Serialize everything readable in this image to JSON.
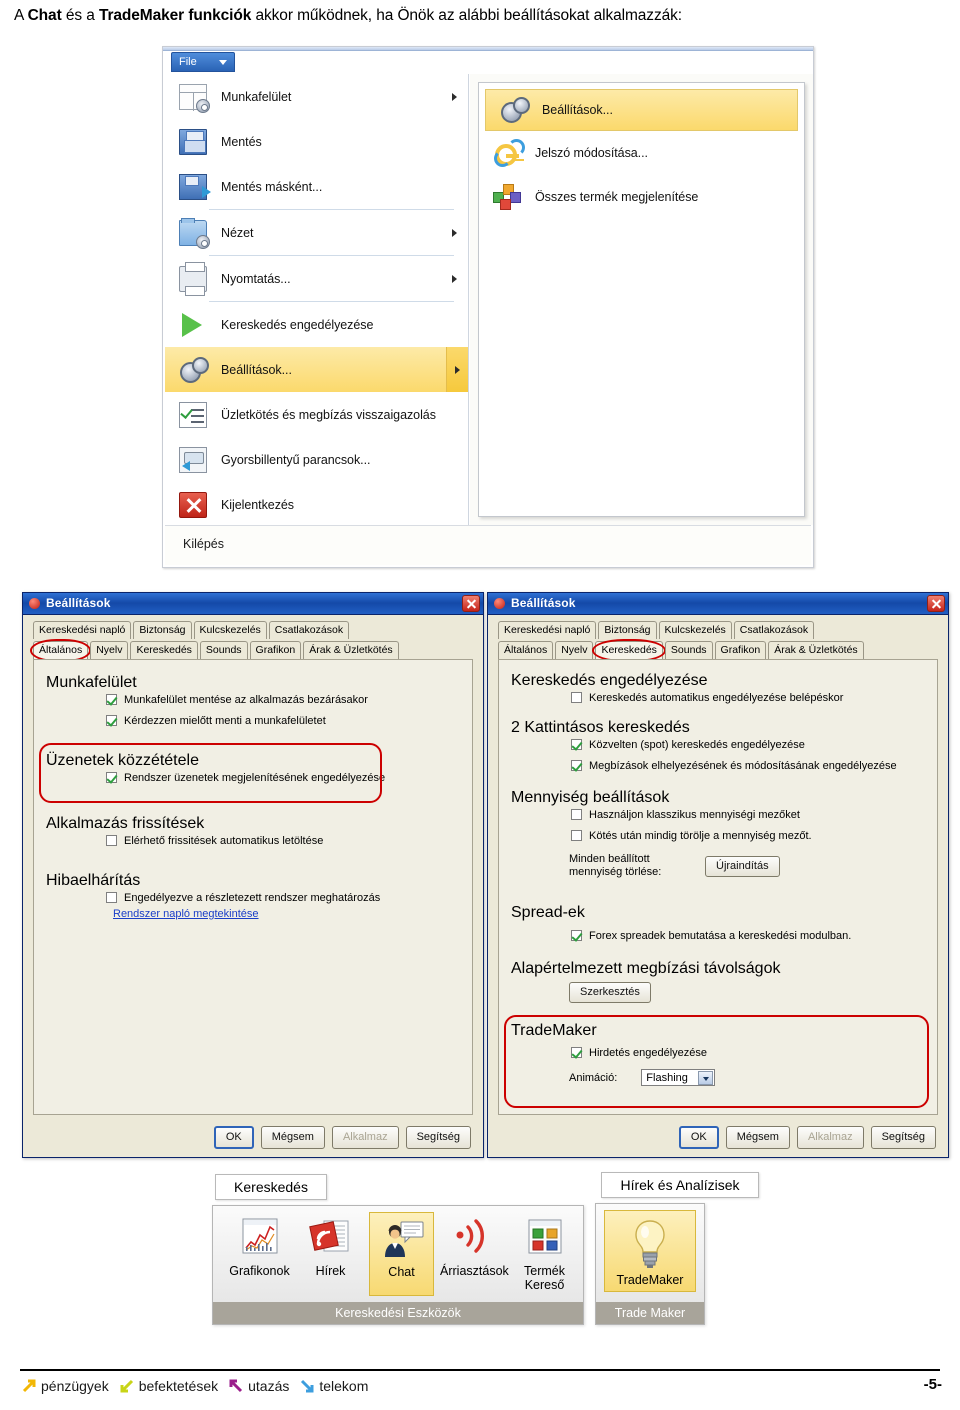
{
  "heading": {
    "pre": "A ",
    "b1": "Chat",
    "mid1": " és a ",
    "b2": "TradeMaker funkciók",
    "post": " akkor működnek, ha Önök az alábbi beállításokat alkalmazzák:"
  },
  "file_menu": {
    "tab_label": "File",
    "exit_label": "Kilépés",
    "left_items": [
      {
        "label": "Munkafelület",
        "icon": "workspace-icon",
        "submenu": true,
        "highlight": false
      },
      {
        "label": "Mentés",
        "icon": "save-icon",
        "submenu": false,
        "highlight": false
      },
      {
        "label": "Mentés másként...",
        "icon": "save-as-icon",
        "submenu": false,
        "highlight": false
      },
      {
        "label": "Nézet",
        "icon": "view-folder-icon",
        "submenu": true,
        "highlight": false
      },
      {
        "label": "Nyomtatás...",
        "icon": "printer-icon",
        "submenu": true,
        "highlight": false
      },
      {
        "label": "Kereskedés engedélyezése",
        "icon": "play-icon",
        "submenu": false,
        "highlight": false
      },
      {
        "label": "Beállítások...",
        "icon": "gear-icon",
        "submenu": true,
        "highlight": true
      },
      {
        "label": "Üzletkötés és megbízás visszaigazolás",
        "icon": "checklist-icon",
        "submenu": false,
        "highlight": false
      },
      {
        "label": "Gyorsbillentyű parancsok...",
        "icon": "keyboard-shortcut-icon",
        "submenu": false,
        "highlight": false
      },
      {
        "label": "Kijelentkezés",
        "icon": "logout-x-icon",
        "submenu": false,
        "highlight": false
      }
    ],
    "right_items": [
      {
        "label": "Beállítások...",
        "icon": "gear-icon",
        "highlight": true
      },
      {
        "label": "Jelszó módosítása...",
        "icon": "key-change-icon",
        "highlight": false
      },
      {
        "label": "Összes termék megjelenítése",
        "icon": "blocks-icon",
        "highlight": false
      }
    ]
  },
  "dialog_left": {
    "title": "Beállítások",
    "tabs_row1": [
      "Kereskedési napló",
      "Biztonság",
      "Kulcskezelés",
      "Csatlakozások"
    ],
    "tabs_row2": [
      "Általános",
      "Nyelv",
      "Kereskedés",
      "Sounds",
      "Grafikon",
      "Árak & Üzletkötés"
    ],
    "selected_tab": "Általános",
    "groups": [
      {
        "title": "Munkafelület",
        "rows": [
          {
            "label": "Munkafelület mentése az alkalmazás bezárásakor",
            "checked": true
          },
          {
            "label": "Kérdezzen mielőtt menti a munkafelületet",
            "checked": true
          }
        ]
      },
      {
        "title": "Üzenetek közzététele",
        "highlighted": true,
        "rows": [
          {
            "label": "Rendszer üzenetek megjelenítésének engedélyezése",
            "checked": true
          }
        ]
      },
      {
        "title": "Alkalmazás frissítések",
        "rows": [
          {
            "label": "Elérhető frissitések automatikus letöltése",
            "checked": false
          }
        ]
      },
      {
        "title": "Hibaelhárítás",
        "rows": [
          {
            "label": "Engedélyezve a részletezett rendszer meghatározás",
            "checked": false
          }
        ],
        "link": "Rendszer napló megtekintése"
      }
    ],
    "buttons": [
      {
        "label": "OK",
        "kind": "default"
      },
      {
        "label": "Mégsem",
        "kind": "normal"
      },
      {
        "label": "Alkalmaz",
        "kind": "disabled"
      },
      {
        "label": "Segítség",
        "kind": "normal"
      }
    ]
  },
  "dialog_right": {
    "title": "Beállítások",
    "tabs_row1": [
      "Kereskedési napló",
      "Biztonság",
      "Kulcskezelés",
      "Csatlakozások"
    ],
    "tabs_row2": [
      "Általános",
      "Nyelv",
      "Kereskedés",
      "Sounds",
      "Grafikon",
      "Árak & Üzletkötés"
    ],
    "selected_tab": "Kereskedés",
    "groups": [
      {
        "title": "Kereskedés engedélyezése",
        "rows": [
          {
            "label": "Kereskedés automatikus engedélyezése belépéskor",
            "checked": false
          }
        ]
      },
      {
        "title": "2 Kattintásos kereskedés",
        "rows": [
          {
            "label": "Közvelten (spot) kereskedés engedélyezése",
            "checked": true
          },
          {
            "label": "Megbízások elhelyezésének és módosításának engedélyezése",
            "checked": true
          }
        ]
      },
      {
        "title": "Mennyiség beállítások",
        "rows": [
          {
            "label": "Használjon klasszikus mennyiségi mezőket",
            "checked": false
          },
          {
            "label": "Kötés után mindig törölje a mennyiség mezőt.",
            "checked": false
          }
        ],
        "reset_label": "Minden beállított mennyiség törlése:",
        "reset_button": "Újraindítás"
      },
      {
        "title": "Spread-ek",
        "rows": [
          {
            "label": "Forex spreadek bemutatása a kereskedési modulban.",
            "checked": true
          }
        ]
      },
      {
        "title": "Alapértelmezett megbízási távolságok",
        "rows": [],
        "edit_button": "Szerkesztés"
      },
      {
        "title": "TradeMaker",
        "highlighted": true,
        "rows": [
          {
            "label": "Hirdetés engedélyezése",
            "checked": true
          }
        ],
        "anim_label": "Animáció:",
        "anim_value": "Flashing"
      }
    ],
    "buttons": [
      {
        "label": "OK",
        "kind": "default"
      },
      {
        "label": "Mégsem",
        "kind": "normal"
      },
      {
        "label": "Alkalmaz",
        "kind": "disabled"
      },
      {
        "label": "Segítség",
        "kind": "normal"
      }
    ]
  },
  "toolbar_trading": {
    "tooltip": "Kereskedés",
    "caption": "Kereskedési Eszközök",
    "buttons": [
      {
        "label": "Grafikonok",
        "icon": "chart-icon",
        "highlight": false
      },
      {
        "label": "Hírek",
        "icon": "rss-news-icon",
        "highlight": false
      },
      {
        "label": "Chat",
        "icon": "chat-person-icon",
        "highlight": true
      },
      {
        "label": "Árriasztások",
        "icon": "price-alert-icon",
        "highlight": false
      },
      {
        "label": "Termék Kereső",
        "icon": "product-finder-icon",
        "highlight": false
      }
    ]
  },
  "toolbar_news": {
    "tooltip": "Hírek és Analízisek",
    "caption": "Trade Maker",
    "buttons": [
      {
        "label": "TradeMaker",
        "icon": "lightbulb-icon",
        "highlight": true
      }
    ]
  },
  "footer": {
    "items": [
      {
        "label": "pénzügyek",
        "color": "#f2b705"
      },
      {
        "label": "befektetések",
        "color": "#c8d417"
      },
      {
        "label": "utazás",
        "color": "#9b1e8c"
      },
      {
        "label": "telekom",
        "color": "#3d9ede"
      }
    ],
    "page": "-5-"
  },
  "colors": {
    "accent_blue": "#1449a8",
    "highlight_yellow": "#f7d972",
    "red_annotation": "#cc0000",
    "dialog_face": "#ece9d8"
  }
}
